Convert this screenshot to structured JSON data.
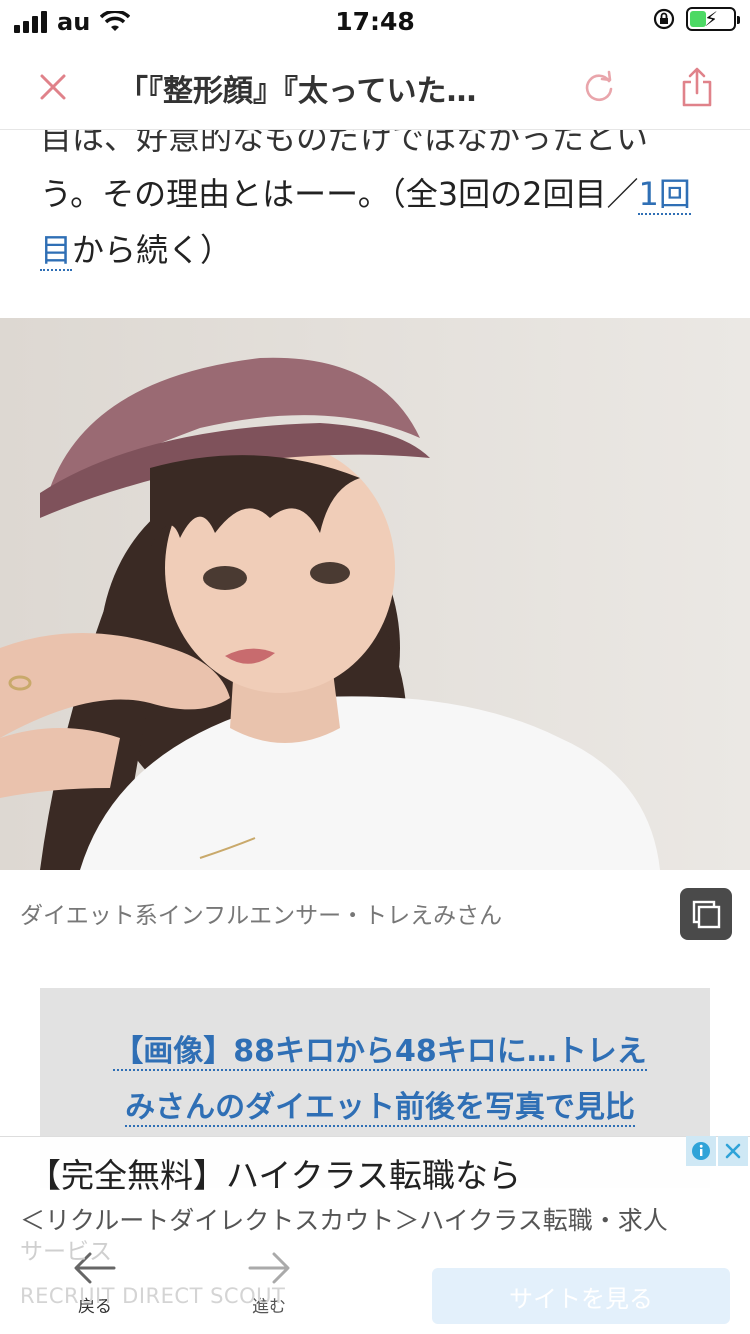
{
  "status_bar": {
    "carrier": "au",
    "time": "17:48"
  },
  "nav": {
    "title": "「『整形顔』『太っていた…"
  },
  "article": {
    "line1_clipped": "目は、好意的なものだけではなかったとい",
    "line2_text": "う。その理由とはーー。（全3回の2回目／",
    "link_part1": "1回",
    "link_part2": "目",
    "line3_rest": "から続く）"
  },
  "photo": {
    "caption": "ダイエット系インフルエンサー・トレえみさん"
  },
  "related": {
    "line1": "【画像】88キロから48キロに…トレえ",
    "line2": "みさんのダイエット前後を写真で見比"
  },
  "ad": {
    "headline": "【完全無料】ハイクラス転職なら",
    "subline": "＜リクルートダイレクトスカウト＞ハイクラス転職・求人",
    "faded_line": "サービス",
    "brand": "RECRUIT DIRECT SCOUT",
    "cta_label": "サイトを見る"
  },
  "toolbar": {
    "back_label": "戻る",
    "forward_label": "進む"
  },
  "colors": {
    "link": "#2f6fb5",
    "close_icon": "#e0828a",
    "battery_fill": "#4cd964"
  }
}
